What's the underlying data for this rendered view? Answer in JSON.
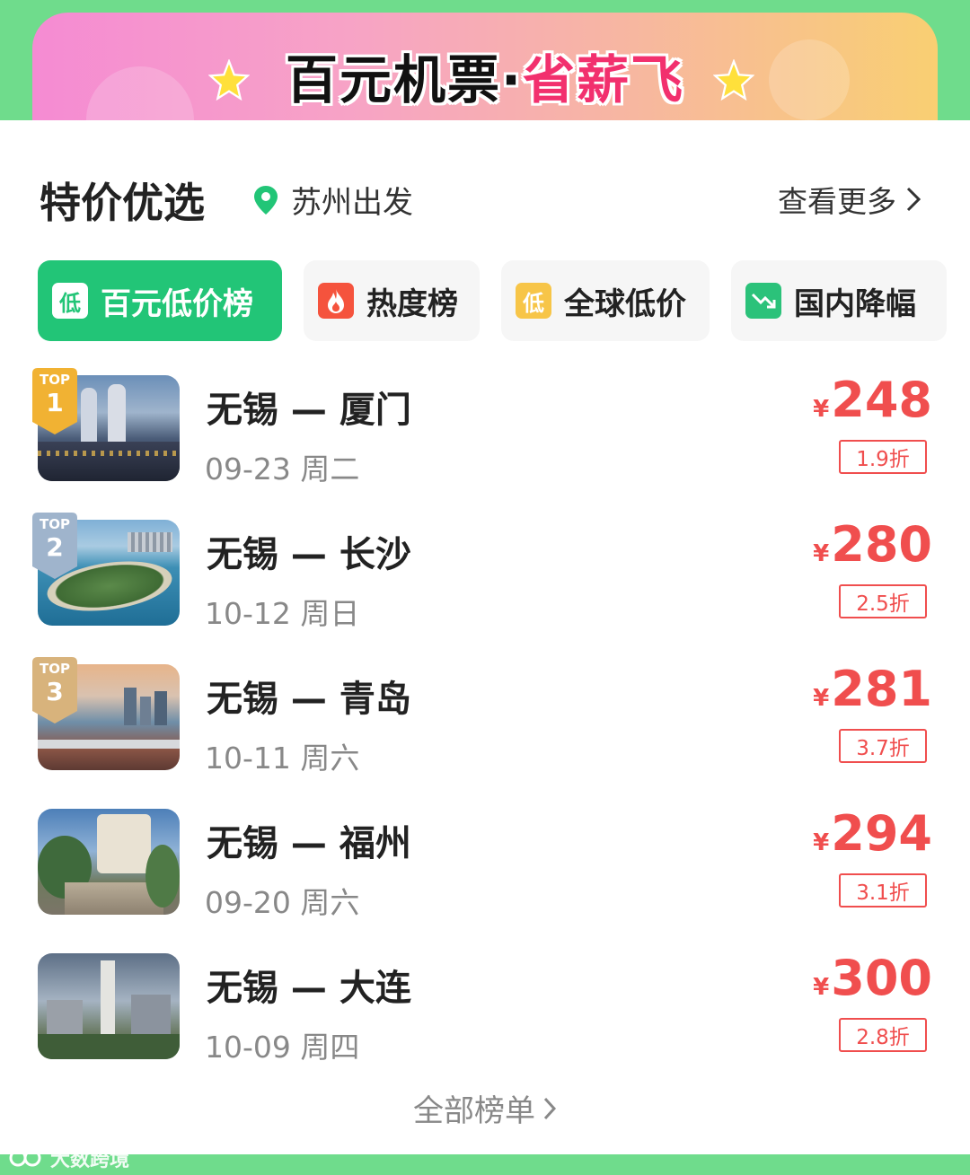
{
  "banner": {
    "title_main": "百元机票·",
    "title_accent": "省薪飞"
  },
  "header": {
    "title": "特价优选",
    "location": "苏州出发",
    "see_more": "查看更多"
  },
  "tabs": [
    {
      "label": "百元低价榜",
      "icon_text": "低",
      "icon": "low-price-icon"
    },
    {
      "label": "热度榜",
      "icon_text": "",
      "icon": "fire-icon"
    },
    {
      "label": "全球低价",
      "icon_text": "低",
      "icon": "low-price-icon"
    },
    {
      "label": "国内降幅",
      "icon_text": "",
      "icon": "trend-down-icon"
    }
  ],
  "flights": [
    {
      "rank_label": "TOP",
      "rank": "1",
      "route": "无锡 — 厦门",
      "date": "09-23 周二",
      "currency": "¥",
      "price": "248",
      "discount": "1.9折"
    },
    {
      "rank_label": "TOP",
      "rank": "2",
      "route": "无锡 — 长沙",
      "date": "10-12 周日",
      "currency": "¥",
      "price": "280",
      "discount": "2.5折"
    },
    {
      "rank_label": "TOP",
      "rank": "3",
      "route": "无锡 — 青岛",
      "date": "10-11 周六",
      "currency": "¥",
      "price": "281",
      "discount": "3.7折"
    },
    {
      "rank_label": "",
      "rank": "",
      "route": "无锡 — 福州",
      "date": "09-20 周六",
      "currency": "¥",
      "price": "294",
      "discount": "3.1折"
    },
    {
      "rank_label": "",
      "rank": "",
      "route": "无锡 — 大连",
      "date": "10-09 周四",
      "currency": "¥",
      "price": "300",
      "discount": "2.8折"
    }
  ],
  "footer": {
    "all_list": "全部榜单"
  },
  "watermark": "大数跨境",
  "colors": {
    "green": "#22c577",
    "price_red": "#f04e4e",
    "accent_pink": "#f2306e"
  }
}
